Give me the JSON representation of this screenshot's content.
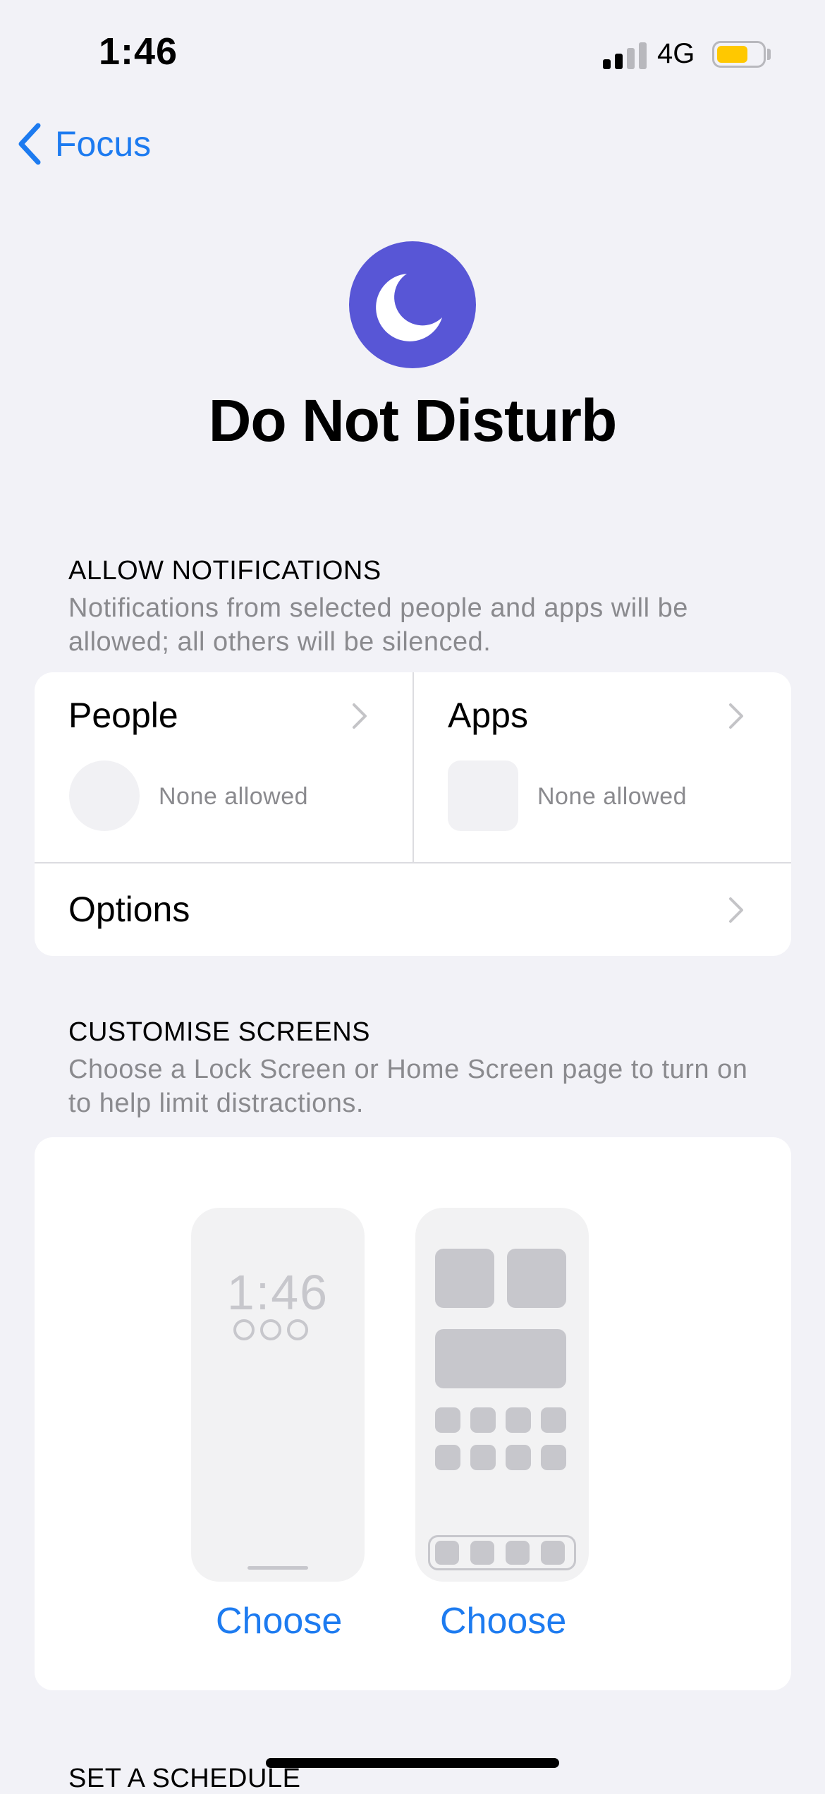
{
  "status_bar": {
    "time": "1:46",
    "network": "4G",
    "signal_bars_filled": 2,
    "signal_bars_total": 4,
    "battery_level": 0.7,
    "battery_color": "#ffc800"
  },
  "nav": {
    "back_label": "Focus",
    "accent_color": "#1d7bf0"
  },
  "hero": {
    "icon": "moon-icon",
    "icon_bg_color": "#5856d6",
    "title": "Do Not Disturb"
  },
  "allow_notifications": {
    "header": "ALLOW NOTIFICATIONS",
    "description": "Notifications from selected people and apps will be allowed; all others will be silenced.",
    "people": {
      "label": "People",
      "status": "None allowed"
    },
    "apps": {
      "label": "Apps",
      "status": "None allowed"
    },
    "options": {
      "label": "Options"
    }
  },
  "customise_screens": {
    "header": "CUSTOMISE SCREENS",
    "description": "Choose a Lock Screen or Home Screen page to turn on to help limit distractions.",
    "lock_preview_time": "1:46",
    "lock_choose": "Choose",
    "home_choose": "Choose"
  },
  "next_section_header": "SET A SCHEDULE"
}
